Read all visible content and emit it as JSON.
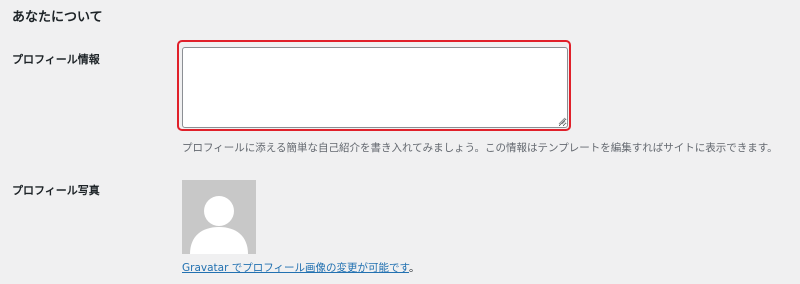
{
  "section": {
    "title": "あなたについて"
  },
  "bio": {
    "label": "プロフィール情報",
    "value": "",
    "description": "プロフィールに添える簡単な自己紹介を書き入れてみましょう。この情報はテンプレートを編集すればサイトに表示できます。"
  },
  "photo": {
    "label": "プロフィール写真",
    "avatar_icon": "default-person-silhouette-icon",
    "link_text": "Gravatar でプロフィール画像の変更が可能です",
    "link_suffix": "。"
  },
  "colors": {
    "page_background": "#f0f0f1",
    "highlight_border": "#e0202a",
    "link": "#2271b1",
    "description_text": "#646970",
    "avatar_background": "#c8c8c8"
  }
}
